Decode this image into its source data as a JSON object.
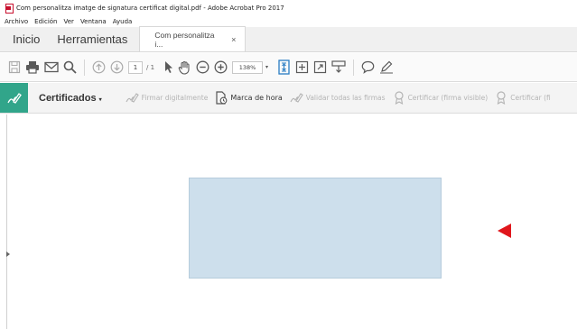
{
  "window": {
    "title": "Com personalitza imatge de signatura certificat digital.pdf - Adobe Acrobat Pro 2017"
  },
  "menu": [
    "Archivo",
    "Edición",
    "Ver",
    "Ventana",
    "Ayuda"
  ],
  "tabs": {
    "home": "Inicio",
    "tools": "Herramientas",
    "document": "Com personalitza i...",
    "close_glyph": "×"
  },
  "toolbar": {
    "page_current": "1",
    "page_total": "/ 1",
    "zoom": "138%",
    "zoom_arrow": "▾"
  },
  "cert_bar": {
    "title": "Certificados",
    "title_caret": "▾",
    "items": [
      {
        "label": "Firmar digitalmente",
        "enabled": false
      },
      {
        "label": "Marca de hora",
        "enabled": true
      },
      {
        "label": "Validar todas las firmas",
        "enabled": false
      },
      {
        "label": "Certificar (firma visible)",
        "enabled": false
      },
      {
        "label": "Certificar (fi",
        "enabled": false
      }
    ]
  },
  "colors": {
    "cert_badge": "#31a58a",
    "signature_field": "#cddfec",
    "annotation_arrow": "#e0161c"
  }
}
